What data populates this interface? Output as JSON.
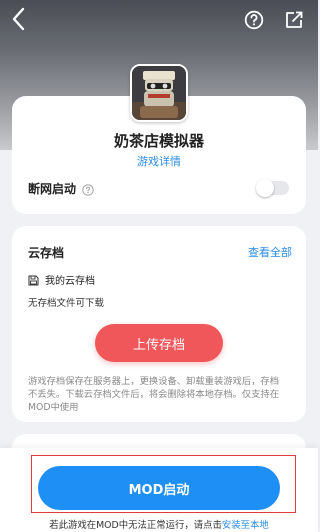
{
  "game": {
    "title": "奶茶店模拟器",
    "detail_link": "游戏详情",
    "icon_name": "game-app-icon"
  },
  "settings": {
    "offline_label": "断网启动",
    "offline_enabled": false
  },
  "cloud": {
    "title": "云存档",
    "view_all": "查看全部",
    "my_save_label": "我的云存档",
    "empty_text": "无存档文件可下载",
    "upload_button": "上传存档",
    "description": "游戏存档保存在服务器上，更换设备、卸载重装游戏后，存档不丢失。下载云存档文件后，将会删除将本地存档。仅支持在MOD中使用"
  },
  "bottom": {
    "mod_button": "MOD启动",
    "note_prefix": "若此游戏在MOD中无法正常运行，请点击",
    "note_link": "安装至本地"
  },
  "colors": {
    "accent_blue": "#1e90f5",
    "link_blue": "#2b8ce6",
    "upload_red": "#f0575b",
    "highlight_red": "#e0383e"
  },
  "icons": {
    "back": "chevron-left-icon",
    "help": "question-circle-icon",
    "share": "share-icon",
    "save": "floppy-disk-icon"
  }
}
